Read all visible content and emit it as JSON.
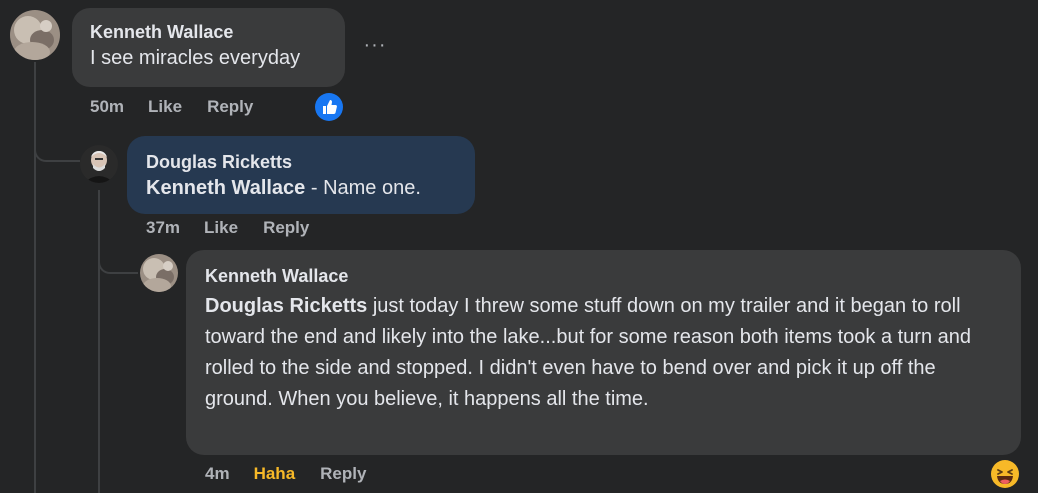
{
  "comments": [
    {
      "author": "Kenneth Wallace",
      "text": "I see miracles everyday",
      "timestamp": "50m",
      "actions": [
        "Like",
        "Reply"
      ],
      "reaction_icon": "like-reaction-icon",
      "more_icon": "more-options-icon",
      "more_glyph": "···"
    },
    {
      "author": "Douglas Ricketts",
      "mention": "Kenneth Wallace",
      "text": " - Name one.",
      "timestamp": "37m",
      "actions": [
        "Like",
        "Reply"
      ]
    },
    {
      "author": "Kenneth Wallace",
      "mention": "Douglas Ricketts",
      "text": " just today I threw some stuff down on my trailer and it began to roll toward the end and likely into the lake...but for some reason both items took a turn and rolled to the side and stopped. I didn't even have to bend over and pick it up off the ground. When you believe, it happens all the time.",
      "timestamp": "4m",
      "actions": [
        "Haha",
        "Reply"
      ],
      "reaction_icon": "haha-reaction-icon"
    }
  ],
  "colors": {
    "background": "#242526",
    "bubble": "#3a3b3c",
    "highlighted_bubble": "#263951",
    "secondary_text": "#b0b3b8",
    "like_blue": "#1877f2",
    "haha_yellow": "#f7b928"
  }
}
